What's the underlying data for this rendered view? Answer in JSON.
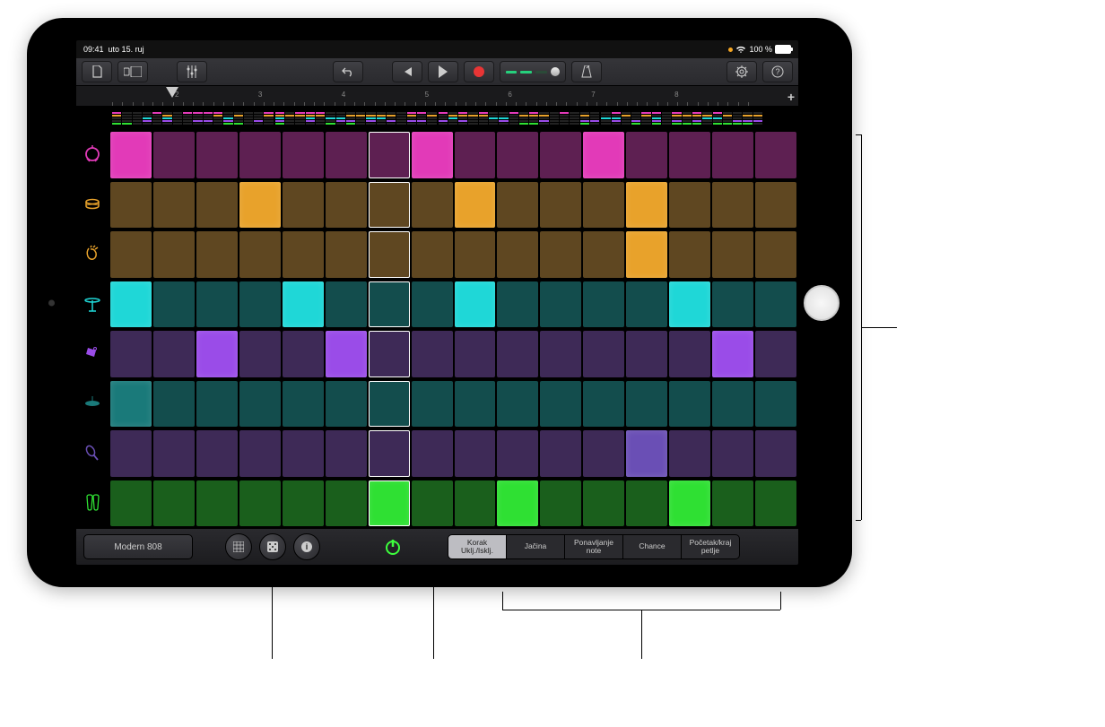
{
  "statusbar": {
    "time": "09:41",
    "date": "uto 15. ruj",
    "battery": "100 %"
  },
  "ruler": {
    "numbers": [
      "2",
      "3",
      "4",
      "5",
      "6",
      "7",
      "8"
    ]
  },
  "preset": {
    "name": "Modern 808"
  },
  "modes": {
    "step": "Korak\nUklj./Isklj.",
    "velocity": "Jačina",
    "repeat": "Ponavljanje\nnote",
    "chance": "Chance",
    "loop": "Početak/kraj\npetlje"
  },
  "rows": [
    {
      "inst": "kick",
      "color": "#e23ab8",
      "dim": "#5e2052",
      "active": [
        0,
        7,
        11
      ],
      "playhead": 6
    },
    {
      "inst": "snare",
      "color": "#e8a22b",
      "dim": "#5f4721",
      "active": [
        3,
        8,
        12
      ],
      "playhead": 6
    },
    {
      "inst": "clap",
      "color": "#e8a22b",
      "dim": "#5f4721",
      "active": [
        12
      ],
      "playhead": 6
    },
    {
      "inst": "hihat",
      "color": "#1fd7d7",
      "dim": "#134d4d",
      "active": [
        0,
        4,
        8,
        13
      ],
      "playhead": 6
    },
    {
      "inst": "perc1",
      "color": "#9a4ce8",
      "dim": "#3e2a57",
      "active": [
        2,
        5,
        14
      ],
      "playhead": 6
    },
    {
      "inst": "perc2",
      "color": "#1a7a7a",
      "dim": "#134d4d",
      "active": [
        0
      ],
      "playhead": 6
    },
    {
      "inst": "shaker",
      "color": "#6a4fb5",
      "dim": "#3e2a57",
      "active": [
        12
      ],
      "playhead": 6
    },
    {
      "inst": "conga",
      "color": "#2fe033",
      "dim": "#1a5f1c",
      "active": [
        6,
        9,
        13
      ],
      "playhead": 6
    }
  ],
  "instColors": {
    "kick": "#e23ab8",
    "snare": "#e8a22b",
    "clap": "#e8a22b",
    "hihat": "#1fd7d7",
    "perc1": "#9a4ce8",
    "perc2": "#1a7a7a",
    "shaker": "#6a4fb5",
    "conga": "#2fe033"
  }
}
